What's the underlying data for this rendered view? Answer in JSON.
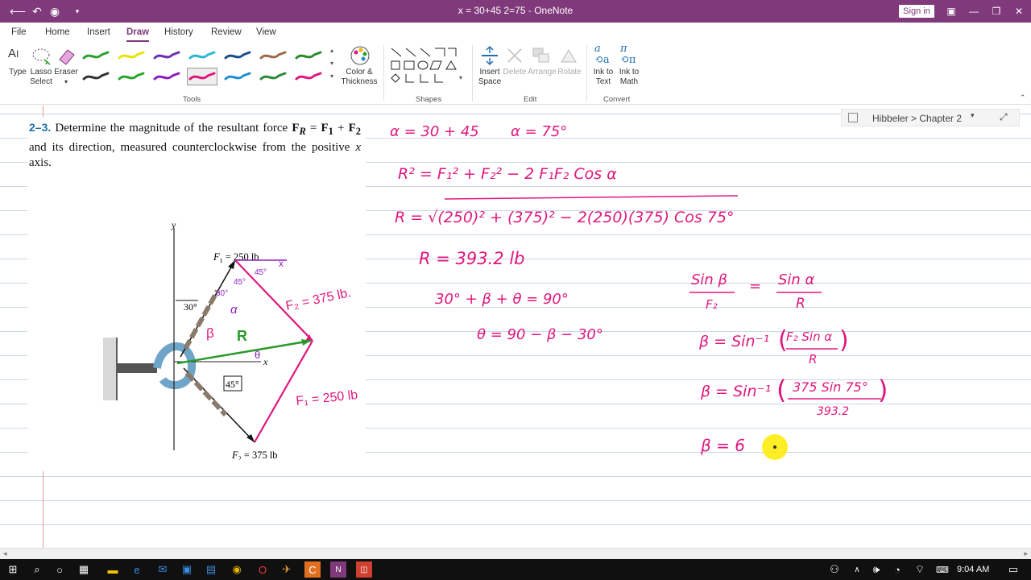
{
  "window": {
    "title": "x = 30+45 2=75  -  OneNote",
    "sign_in": "Sign in"
  },
  "tabs": [
    "File",
    "Home",
    "Insert",
    "Draw",
    "History",
    "Review",
    "View"
  ],
  "active_tab": "Draw",
  "ribbon": {
    "tools": {
      "type_label": "Type",
      "lasso_label_1": "Lasso",
      "lasso_label_2": "Select",
      "eraser_label": "Eraser",
      "group_label": "Tools",
      "pens_row1": [
        "#2aa52a",
        "#e6e600",
        "#6b2fb3",
        "#2ab7d6",
        "#1b4f8a",
        "#9b6b4a",
        "#2a8a2a"
      ],
      "pens_row2": [
        "#333333",
        "#2aa52a",
        "#8b1fbf",
        "#e0187d",
        "#1f8fd0",
        "#2d8a3a",
        "#e0187d"
      ],
      "color_label_1": "Color &",
      "color_label_2": "Thickness"
    },
    "shapes": {
      "group_label": "Shapes"
    },
    "edit": {
      "insert_space_1": "Insert",
      "insert_space_2": "Space",
      "delete_label": "Delete",
      "arrange_label": "Arrange",
      "rotate_label": "Rotate",
      "group_label": "Edit"
    },
    "convert": {
      "ink_text_1": "Ink to",
      "ink_text_2": "Text",
      "ink_math_1": "Ink to",
      "ink_math_2": "Math",
      "group_label": "Convert"
    }
  },
  "breadcrumb": "Hibbeler > Chapter 2",
  "problem": {
    "number": "2–3.",
    "text_a": "Determine the magnitude of the resultant force",
    "text_b": "and its direction, measured counterclockwise",
    "text_c": "from the positive",
    "text_d": "axis.",
    "fr": "F",
    "fr_sub": "R",
    "f1": "F",
    "f1_sub": "1",
    "f2": "F",
    "f2_sub": "2",
    "x_var": "x"
  },
  "figure": {
    "y_label": "y",
    "x_label": "x",
    "f1_label": "F",
    "f1_sub": "1",
    "f1_value": " = 250 lb",
    "f2_label": "F",
    "f2_sub": "2",
    "f2_value": " = 375 lb",
    "angle_30": "30°",
    "angle_45": "45°"
  },
  "annotations": {
    "fig_f2": "F₂ = 375 lb.",
    "fig_f1": "F₁ = 250 lb",
    "fig_r": "R",
    "fig_beta": "β",
    "fig_alpha": "α",
    "fig_theta": "θ",
    "fig_30": "30°",
    "fig_45a": "45°",
    "fig_45b": "45°",
    "fig_x": "x"
  },
  "ink": {
    "line1a": "α = 30 + 45",
    "line1b": "α = 75°",
    "line2": "R² =  F₁² + F₂² − 2 F₁F₂ Cos α",
    "line3": "R  = √(250)² + (375)² − 2(250)(375) Cos 75°",
    "line4": "R = 393.2 lb",
    "line5": "30° + β + θ = 90°",
    "line6": "θ = 90 − β − 30°",
    "sin_beta": "Sin β",
    "over_f2": "F₂",
    "equals": "=",
    "sin_alpha": "Sin α",
    "over_r": "R",
    "beta_eq1": "β =  Sin⁻¹",
    "frac1_num": "F₂ Sin α",
    "frac1_den": "R",
    "beta_eq2": "β =  Sin⁻¹",
    "frac2_num": "375 Sin 75°",
    "frac2_den": "393.2",
    "beta_eq3": "β =  6"
  },
  "taskbar": {
    "time": "9:04 AM"
  }
}
